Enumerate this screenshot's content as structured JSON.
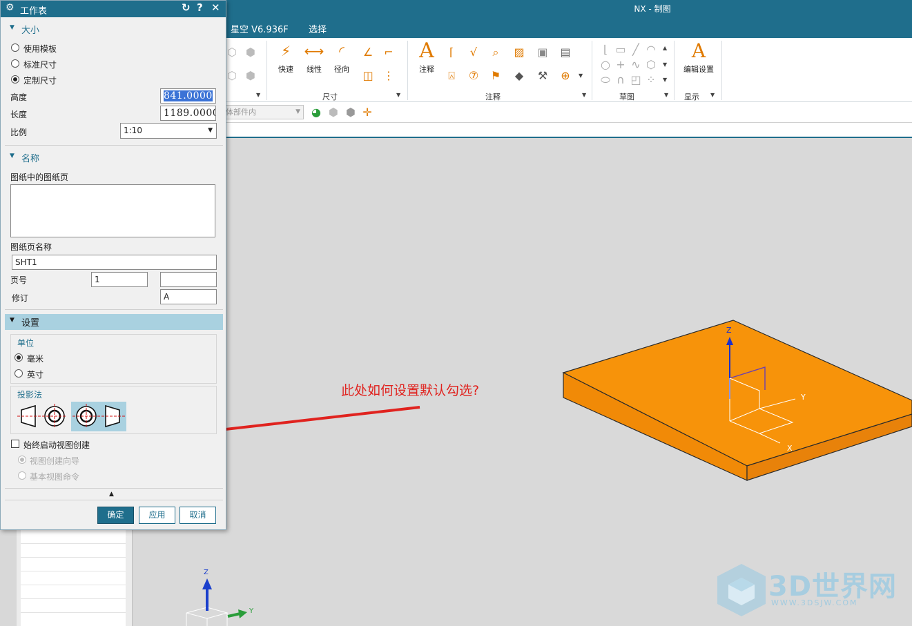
{
  "app": {
    "title": "NX - 制图"
  },
  "menu": {
    "items": [
      "星空 V6.936F",
      "选择"
    ]
  },
  "ribbon": {
    "dimension_group": {
      "label": "尺寸",
      "buttons": [
        "快速",
        "线性",
        "径向"
      ]
    },
    "annotation_group": {
      "label": "注释",
      "buttons": [
        "注释"
      ]
    },
    "sketch_group": {
      "label": "草图"
    },
    "display_group": {
      "label": "显示",
      "buttons": [
        "编辑设置"
      ]
    }
  },
  "toolbar2": {
    "filter_placeholder": "体部件内"
  },
  "dialog": {
    "title": "工作表",
    "size_section": {
      "title": "大小",
      "options": [
        "使用模板",
        "标准尺寸",
        "定制尺寸"
      ],
      "selected": "定制尺寸",
      "height_label": "高度",
      "height_value": "841.0000",
      "length_label": "长度",
      "length_value": "1189.0000",
      "scale_label": "比例",
      "scale_value": "1:10"
    },
    "name_section": {
      "title": "名称",
      "sheets_label": "图纸中的图纸页",
      "sheet_name_label": "图纸页名称",
      "sheet_name_value": "SHT1",
      "page_no_label": "页号",
      "page_no_value": "1",
      "page_no_value2": "",
      "revision_label": "修订",
      "revision_value": "A"
    },
    "settings_section": {
      "title": "设置",
      "units_label": "单位",
      "unit_options": [
        "毫米",
        "英寸"
      ],
      "unit_selected": "毫米",
      "projection_label": "投影法",
      "always_start_label": "始终启动视图创建",
      "always_start_checked": false,
      "view_options": [
        "视图创建向导",
        "基本视图命令"
      ]
    },
    "buttons": {
      "ok": "确定",
      "apply": "应用",
      "cancel": "取消"
    }
  },
  "annotation": {
    "text": "此处如何设置默认勾选?"
  },
  "axes": {
    "z": "Z",
    "y": "Y",
    "x": "X"
  },
  "watermark": {
    "brand": "3D世界网",
    "url": "WWW.3DSJW.COM"
  },
  "colors": {
    "titlebar": "#1f6e8c",
    "part": "#f7930a",
    "annotation": "#e0231f"
  }
}
